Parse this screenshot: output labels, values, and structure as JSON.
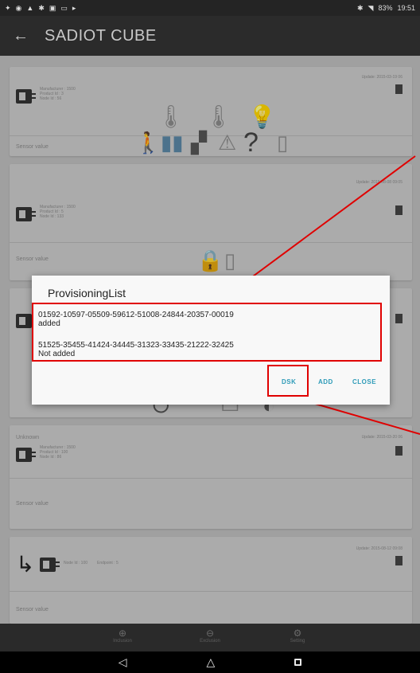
{
  "status_bar": {
    "time": "19:51",
    "battery": "83%"
  },
  "app_bar": {
    "title": "SADIOT CUBE",
    "back_icon": "arrow-left-icon"
  },
  "dialog": {
    "title": "ProvisioningList",
    "entries": [
      {
        "code": "01592-10597-05509-59612-51008-24844-20357-00019",
        "status": "added"
      },
      {
        "code": "51525-35455-41424-34445-31323-33435-21222-32425",
        "status": "Not added"
      }
    ],
    "buttons": {
      "dsk": "DSK",
      "add": "ADD",
      "close": "CLOSE"
    }
  },
  "cards": {
    "card1": {
      "updated": "Update: 2015-03-19 06",
      "meta": [
        "Manufacturer : 1500",
        "Product Id : 3",
        "Node Id : 56"
      ],
      "label": "Sensor value"
    },
    "card2": {
      "updated": "Update: 2015-08-08 09:05",
      "meta": [
        "Manufacturer : 1500",
        "Product Id : 5",
        "Node Id : 133"
      ],
      "label": "Sensor value"
    },
    "card4": {
      "title": "Unknown",
      "updated": "Update: 2015-03-20 06",
      "meta": [
        "Manufacturer : 1500",
        "Product Id : 100",
        "Node Id : 86"
      ],
      "label": "Sensor value"
    },
    "card5": {
      "updated": "Update: 2015-08-12 09:08",
      "meta": [
        "Node Id : 100",
        "Endpoint : 5"
      ],
      "label": "Sensor value"
    }
  },
  "bottom_nav": {
    "items": [
      "Inclusion",
      "Exclusion",
      "Setting"
    ]
  }
}
